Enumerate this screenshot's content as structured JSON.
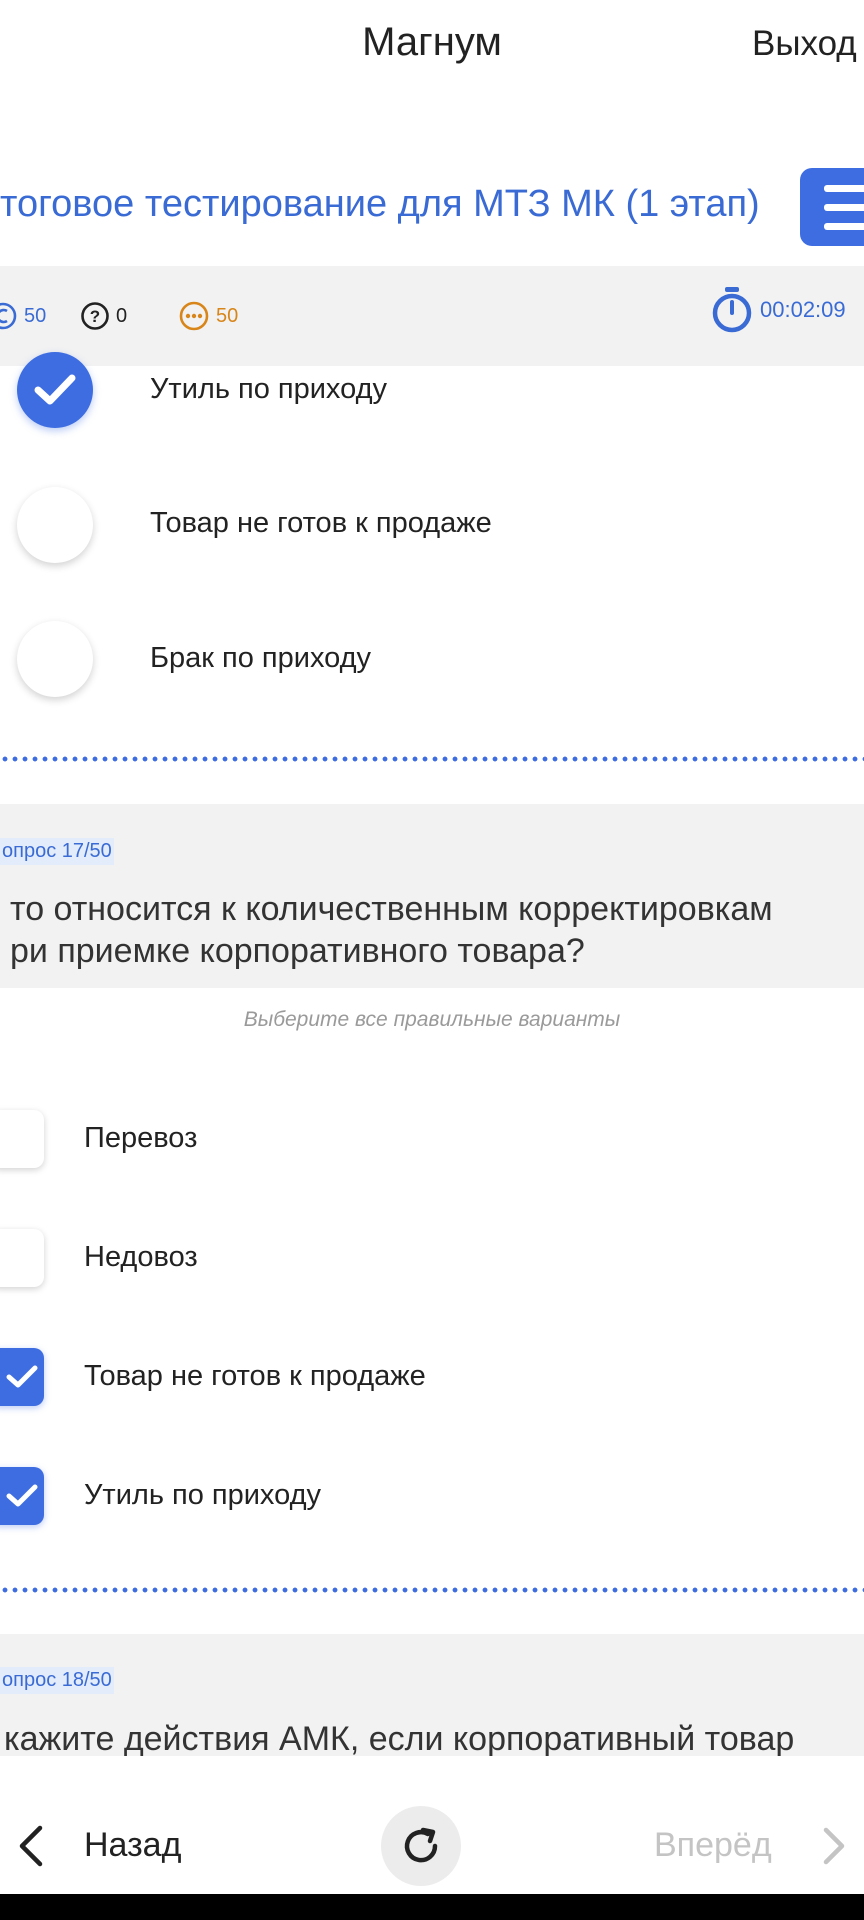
{
  "header": {
    "app_title": "Магнум",
    "exit_label": "Выход",
    "test_title": "тоговое тестирование для МТЗ МК (1 этап)"
  },
  "stats": {
    "answered": "50",
    "unknown": "0",
    "remaining": "50",
    "timer": "00:02:09"
  },
  "prev_question": {
    "options": [
      {
        "label": "Утиль по приходу",
        "selected": true
      },
      {
        "label": "Товар не готов к продаже",
        "selected": false
      },
      {
        "label": "Брак по приходу",
        "selected": false
      }
    ]
  },
  "question_17": {
    "number": "опрос 17/50",
    "text_line1": "то относится к количественным корректировкам",
    "text_line2": "ри приемке корпоративного товара?",
    "hint": "Выберите все правильные варианты",
    "options": [
      {
        "label": "Перевоз",
        "checked": false
      },
      {
        "label": "Недовоз",
        "checked": false
      },
      {
        "label": "Товар не готов к продаже",
        "checked": true
      },
      {
        "label": "Утиль по приходу",
        "checked": true
      }
    ]
  },
  "question_18": {
    "number": "опрос 18/50",
    "text_line1": "кажите действия АМК, если корпоративный товар"
  },
  "nav": {
    "back_label": "Назад",
    "forward_label": "Вперёд"
  },
  "colors": {
    "accent": "#3d6de1",
    "accent_text": "#3a6bd4",
    "warning": "#d8861a",
    "stats_bg": "#f2f2f2",
    "disabled": "#c4c4c4"
  },
  "icons": {
    "answered": "answered-circle-icon",
    "unknown": "question-circle-icon",
    "remaining": "dots-circle-icon",
    "timer": "stopwatch-icon",
    "menu": "hamburger-icon",
    "back": "chevron-left-icon",
    "forward": "chevron-right-icon",
    "refresh": "refresh-icon",
    "check": "check-icon"
  }
}
